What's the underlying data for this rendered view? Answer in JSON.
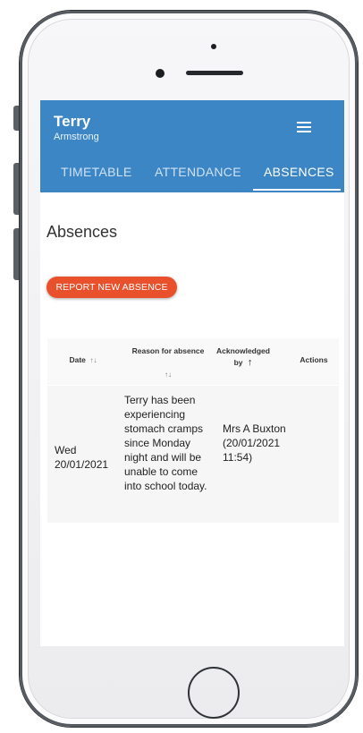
{
  "header": {
    "first_name": "Terry",
    "last_name": "Armstrong"
  },
  "tabs": [
    {
      "label": "TIMETABLE"
    },
    {
      "label": "ATTENDANCE"
    },
    {
      "label": "ABSENCES"
    }
  ],
  "active_tab": "ABSENCES",
  "page": {
    "heading": "Absences",
    "report_button": "REPORT NEW ABSENCE"
  },
  "table": {
    "headers": {
      "date": "Date",
      "reason": "Reason for absence",
      "acknowledged": "Acknowledged by",
      "actions": "Actions"
    },
    "rows": [
      {
        "date": "Wed 20/01/2021",
        "reason": "Terry has been experiencing stomach cramps since Monday night and will be unable to come into school today.",
        "acknowledged": "Mrs A Buxton (20/01/2021 11:54)"
      }
    ]
  },
  "colors": {
    "appbar": "#3d86c6",
    "report_button": "#e9512c"
  }
}
